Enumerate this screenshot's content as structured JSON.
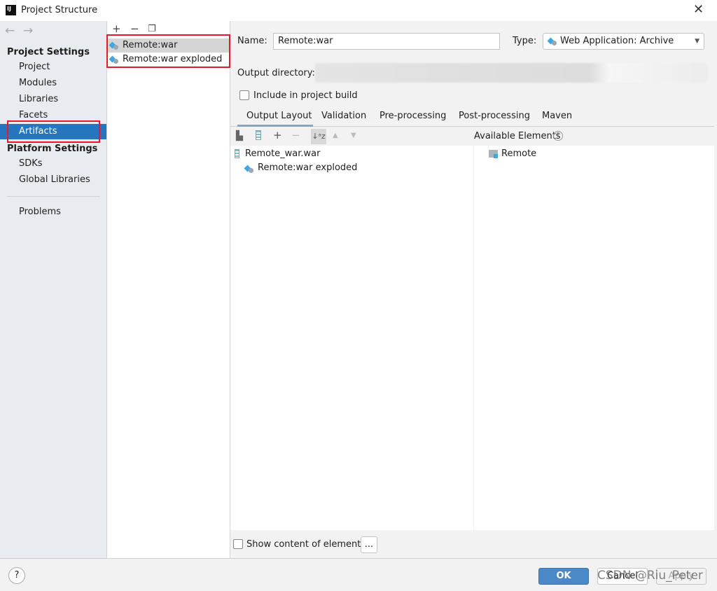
{
  "window": {
    "title": "Project Structure",
    "logo": "IJ"
  },
  "sidebar": {
    "project_settings": "Project Settings",
    "project_items": [
      "Project",
      "Modules",
      "Libraries",
      "Facets",
      "Artifacts"
    ],
    "platform_settings": "Platform Settings",
    "platform_items": [
      "SDKs",
      "Global Libraries"
    ],
    "problems": "Problems",
    "selected": "Artifacts"
  },
  "artifacts": {
    "items": [
      "Remote:war",
      "Remote:war exploded"
    ],
    "selected": "Remote:war"
  },
  "form": {
    "name_label": "Name:",
    "name_value": "Remote:war",
    "type_label": "Type:",
    "type_value": "Web Application: Archive",
    "output_label": "Output directory:",
    "include_label": "Include in project build",
    "include_checked": false
  },
  "tabs": [
    "Output Layout",
    "Validation",
    "Pre-processing",
    "Post-processing",
    "Maven"
  ],
  "active_tab": "Output Layout",
  "layout": {
    "tree": [
      "Remote_war.war",
      "Remote:war exploded"
    ],
    "available_label": "Available Elements",
    "available": [
      "Remote"
    ],
    "show_content_label": "Show content of elements",
    "more_button": "..."
  },
  "buttons": {
    "ok": "OK",
    "cancel": "Cancel",
    "apply": "Apply",
    "help": "?"
  },
  "watermark": "CSDN @Riu_Peter",
  "colors": {
    "accent": "#2675bf",
    "highlight": "#e8182b",
    "ok": "#4a88c7"
  }
}
